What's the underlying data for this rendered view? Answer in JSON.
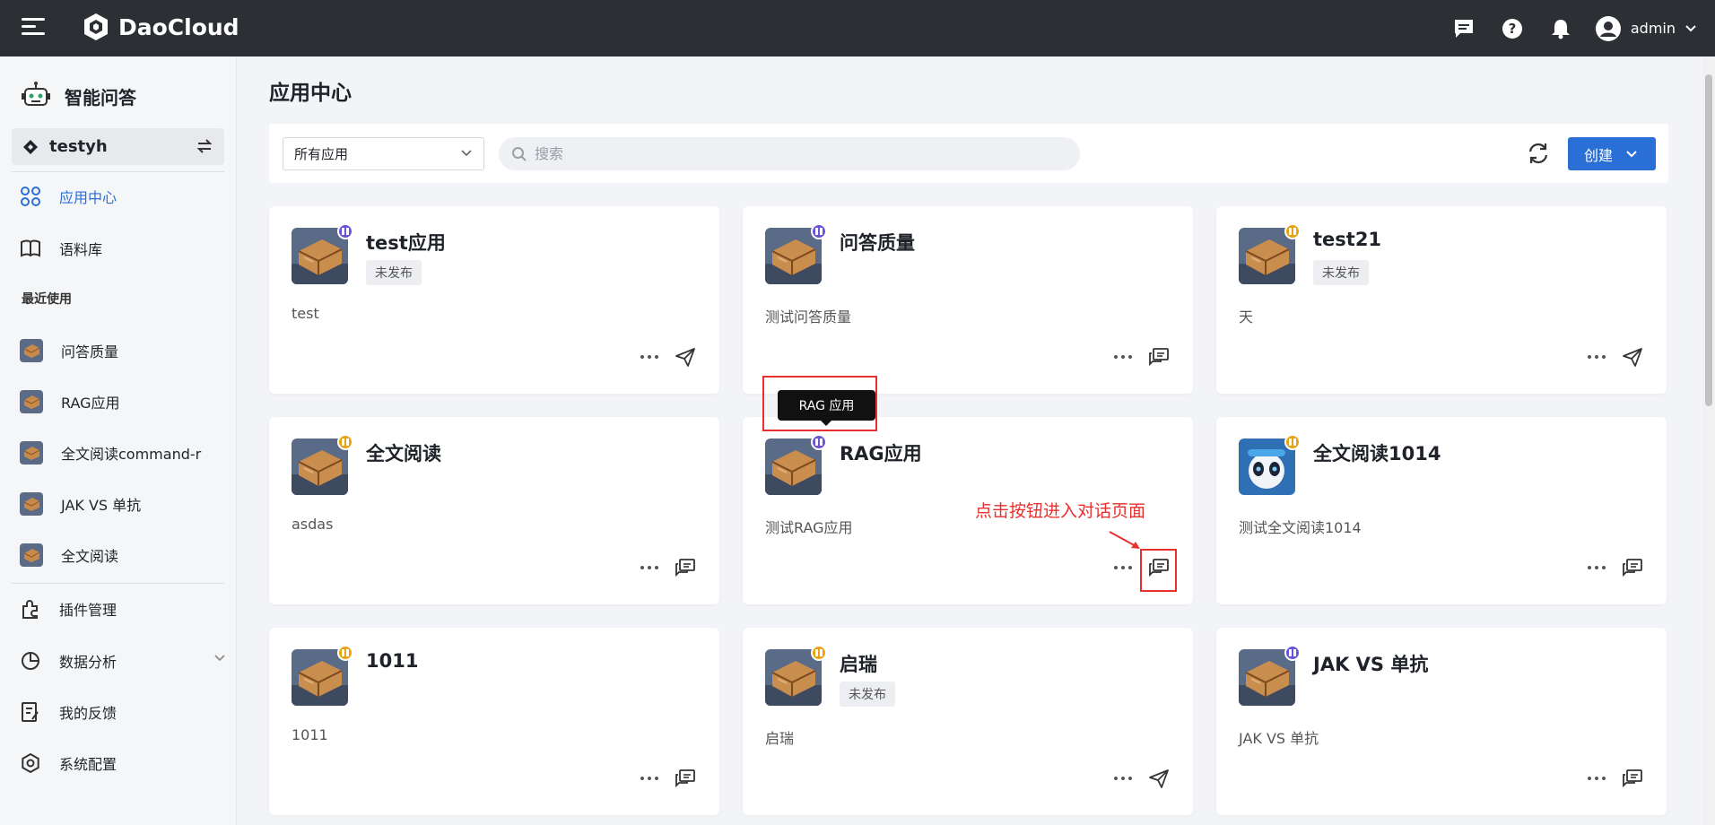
{
  "header": {
    "brand": "DaoCloud",
    "user": "admin"
  },
  "sidebar": {
    "app_title": "智能问答",
    "workspace": "testyh",
    "nav": {
      "app_center": "应用中心",
      "corpus": "语料库"
    },
    "recent_title": "最近使用",
    "recent": [
      "问答质量",
      "RAG应用",
      "全文阅读command-r",
      "JAK VS 单抗",
      "全文阅读"
    ],
    "bottom": {
      "plugins": "插件管理",
      "analytics": "数据分析",
      "feedback": "我的反馈",
      "settings": "系统配置"
    }
  },
  "main": {
    "title": "应用中心",
    "filter": {
      "selected": "所有应用"
    },
    "search": {
      "placeholder": "搜索"
    },
    "create_label": "创建"
  },
  "cards": [
    {
      "name": "test应用",
      "status": "未发布",
      "desc": "test",
      "badge": "purple",
      "action": "send"
    },
    {
      "name": "问答质量",
      "status": "",
      "desc": "测试问答质量",
      "badge": "purple",
      "action": "chat"
    },
    {
      "name": "test21",
      "status": "未发布",
      "desc": "天",
      "badge": "orange",
      "action": "send"
    },
    {
      "name": "全文阅读",
      "status": "",
      "desc": "asdas",
      "badge": "orange",
      "action": "chat"
    },
    {
      "name": "RAG应用",
      "status": "",
      "desc": "测试RAG应用",
      "badge": "purple",
      "action": "chat"
    },
    {
      "name": "全文阅读1014",
      "status": "",
      "desc": "测试全文阅读1014",
      "badge": "orange",
      "action": "chat"
    },
    {
      "name": "1011",
      "status": "",
      "desc": "1011",
      "badge": "orange",
      "action": "chat"
    },
    {
      "name": "启瑞",
      "status": "未发布",
      "desc": "启瑞",
      "badge": "orange",
      "action": "send"
    },
    {
      "name": "JAK VS 单抗",
      "status": "",
      "desc": "JAK VS 单抗",
      "badge": "purple",
      "action": "chat"
    }
  ],
  "tooltip": "RAG 应用",
  "annotation": "点击按钮进入对话页面",
  "colors": {
    "accent": "#2a6fd6",
    "topbar": "#2c2f33",
    "badge_purple": "#6a52d9",
    "badge_orange": "#e8a314",
    "annotation_red": "#e8302e"
  }
}
